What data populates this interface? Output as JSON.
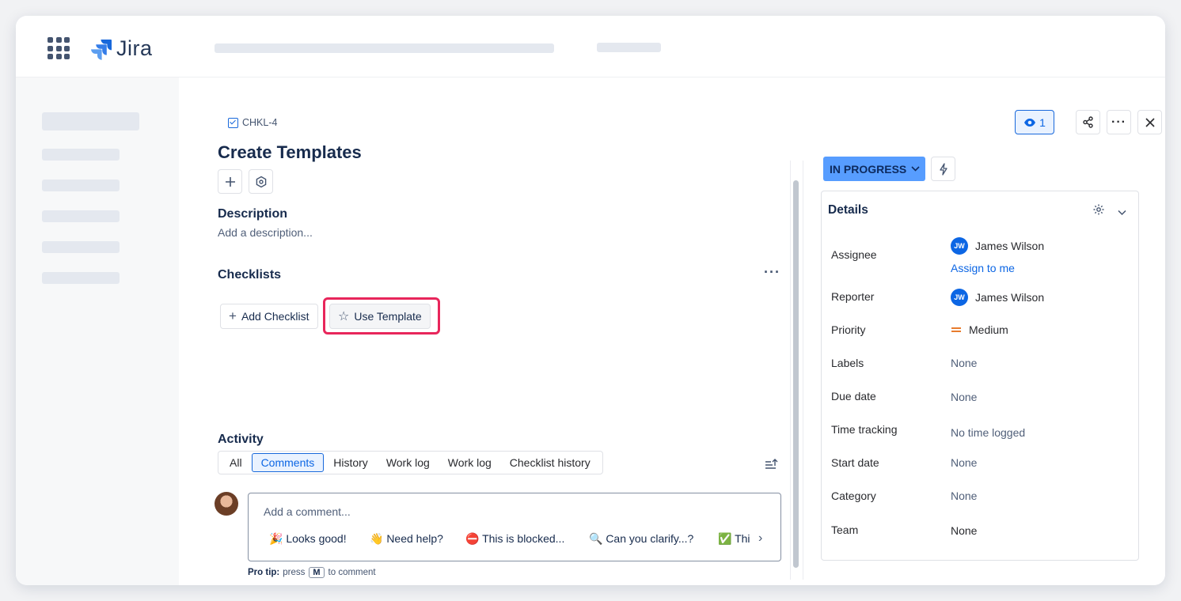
{
  "app": {
    "name": "Jira"
  },
  "issue": {
    "key": "CHKL-4",
    "title": "Create Templates",
    "status": "IN PROGRESS",
    "watchers": "1"
  },
  "description": {
    "label": "Description",
    "placeholder": "Add a description..."
  },
  "checklists": {
    "label": "Checklists",
    "add_label": "Add Checklist",
    "template_label": "Use Template"
  },
  "activity": {
    "label": "Activity",
    "tabs": [
      "All",
      "Comments",
      "History",
      "Work log",
      "Work log",
      "Checklist history"
    ],
    "active_tab": "Comments",
    "comment_placeholder": "Add a comment...",
    "quick_replies": [
      "🎉 Looks good!",
      "👋 Need help?",
      "⛔ This is blocked...",
      "🔍 Can you clarify...?",
      "✅ Thi"
    ],
    "pro_tip_label": "Pro tip:",
    "pro_tip_press": "press",
    "pro_tip_key": "M",
    "pro_tip_suffix": "to comment"
  },
  "details": {
    "title": "Details",
    "fields": {
      "assignee": {
        "label": "Assignee",
        "value": "James Wilson",
        "initials": "JW",
        "action": "Assign to me"
      },
      "reporter": {
        "label": "Reporter",
        "value": "James Wilson",
        "initials": "JW"
      },
      "priority": {
        "label": "Priority",
        "value": "Medium"
      },
      "labels": {
        "label": "Labels",
        "value": "None"
      },
      "due_date": {
        "label": "Due date",
        "value": "None"
      },
      "time_tracking": {
        "label": "Time tracking",
        "value": "No time logged"
      },
      "start_date": {
        "label": "Start date",
        "value": "None"
      },
      "category": {
        "label": "Category",
        "value": "None"
      },
      "team": {
        "label": "Team",
        "value": "None"
      }
    }
  },
  "colors": {
    "accent": "#0c66e4",
    "status_bg": "#579dff",
    "highlight": "#e8265b",
    "priority_medium": "#e56910"
  }
}
